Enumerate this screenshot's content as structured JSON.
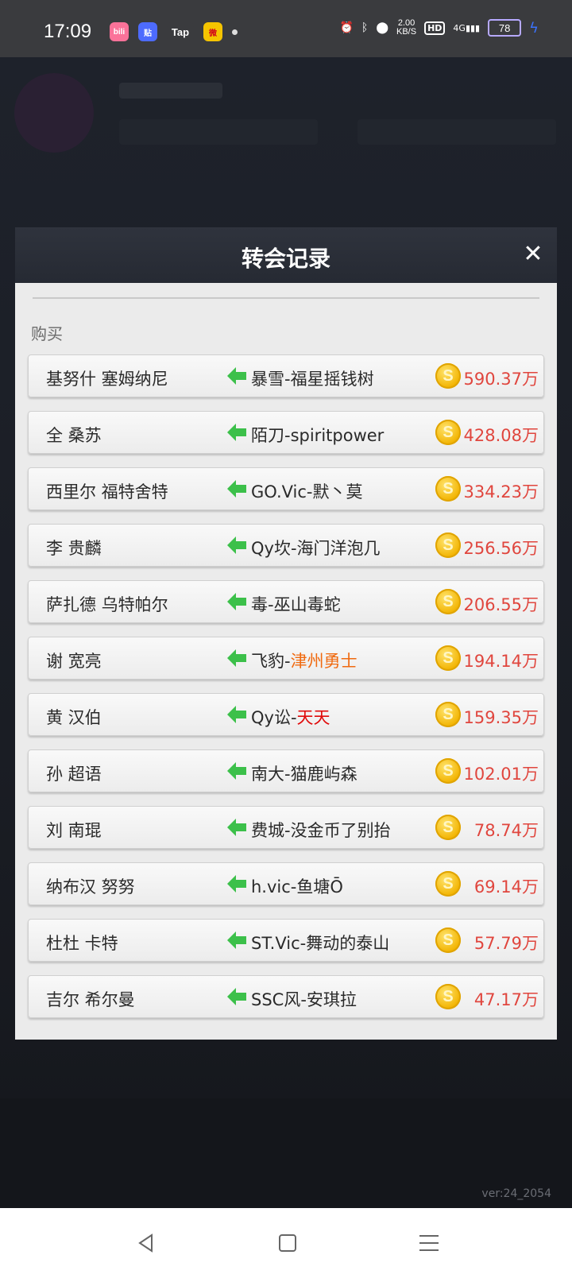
{
  "status_bar": {
    "time": "17:09",
    "app_icons": [
      {
        "label": "bili",
        "icon": "bilibili-icon",
        "color": "#fb7299"
      },
      {
        "label": "贴",
        "icon": "tieba-icon",
        "color": "#4d6bfe"
      },
      {
        "label": "Tap",
        "icon": "taptap-icon",
        "color": "#3a3b3e"
      },
      {
        "label": "微",
        "icon": "weibo-icon",
        "color": "#f5c400"
      }
    ],
    "net_speed_value": "2.00",
    "net_speed_unit": "KB/S",
    "hd_label": "HD",
    "signal_label": "4G",
    "battery": "78"
  },
  "modal": {
    "title": "转会记录",
    "close_icon": "close-icon",
    "section_label": "购买",
    "records": [
      {
        "player": "基努什 塞姆纳尼",
        "seller": "暴雪-福星摇钱树",
        "seller_highlight": "",
        "highlight_color": "",
        "price": "590.37万"
      },
      {
        "player": "全 桑苏",
        "seller": "陌刀-spiritpower",
        "seller_highlight": "",
        "highlight_color": "",
        "price": "428.08万"
      },
      {
        "player": "西里尔 福特舍特",
        "seller": "GO.Vic-默丶莫",
        "seller_highlight": "",
        "highlight_color": "",
        "price": "334.23万"
      },
      {
        "player": "李 贵麟",
        "seller": "Qy坎-海门洋泡几",
        "seller_highlight": "",
        "highlight_color": "",
        "price": "256.56万"
      },
      {
        "player": "萨扎德 乌特帕尔",
        "seller": "毒-巫山毒蛇",
        "seller_highlight": "",
        "highlight_color": "",
        "price": "206.55万"
      },
      {
        "player": "谢 宽亮",
        "seller": "飞豹-",
        "seller_highlight": "津州勇士",
        "highlight_color": "orange",
        "price": "194.14万"
      },
      {
        "player": "黄 汉伯",
        "seller": "Qy讼-",
        "seller_highlight": "天天",
        "highlight_color": "red",
        "price": "159.35万"
      },
      {
        "player": "孙 超语",
        "seller": "南大-猫鹿屿森",
        "seller_highlight": "",
        "highlight_color": "",
        "price": "102.01万"
      },
      {
        "player": "刘 南琨",
        "seller": "费城-没金币了别抬",
        "seller_highlight": "",
        "highlight_color": "",
        "price": "78.74万"
      },
      {
        "player": "纳布汉 努努",
        "seller": "h.vic-鱼塘Ō",
        "seller_highlight": "",
        "highlight_color": "",
        "price": "69.14万"
      },
      {
        "player": "杜杜 卡特",
        "seller": "ST.Vic-舞动的泰山",
        "seller_highlight": "",
        "highlight_color": "",
        "price": "57.79万"
      },
      {
        "player": "吉尔 希尔曼",
        "seller": "SSC风-安琪拉",
        "seller_highlight": "",
        "highlight_color": "",
        "price": "47.17万"
      }
    ]
  },
  "background": {
    "version": "ver:24_2054"
  },
  "nav_bar": {
    "buttons": [
      "back-icon",
      "home-icon",
      "recents-icon"
    ]
  }
}
